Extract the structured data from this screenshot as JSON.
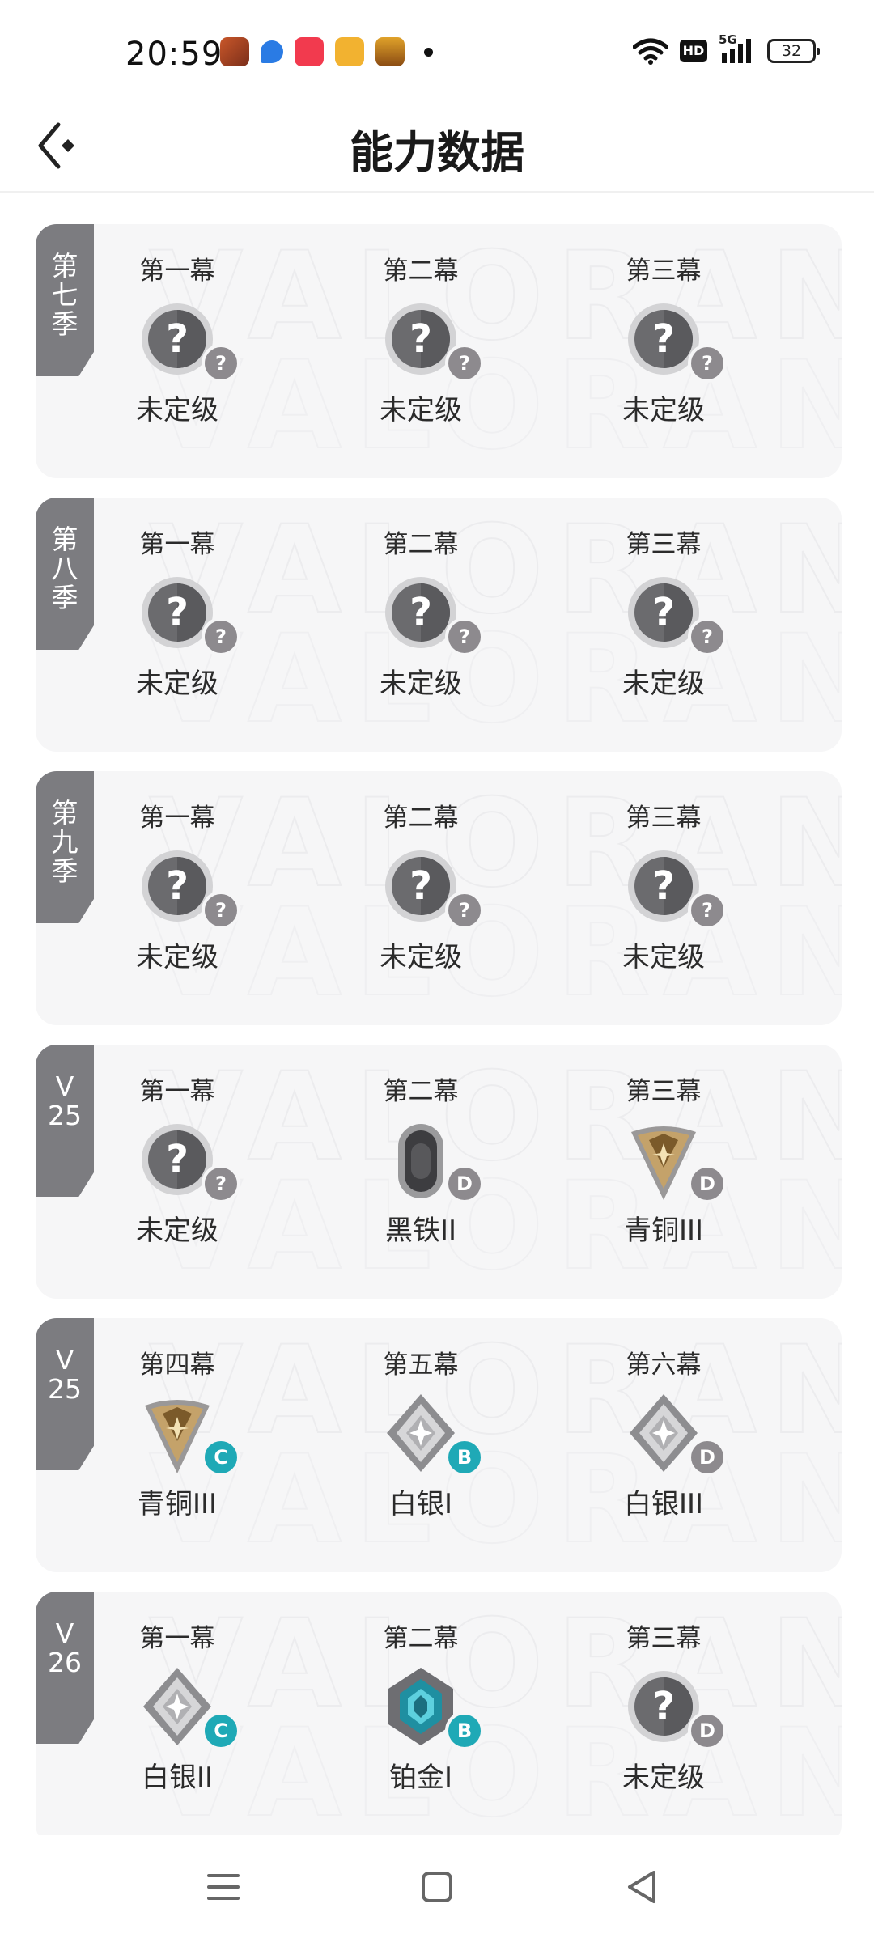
{
  "status_bar": {
    "time": "20:59",
    "battery": "32",
    "hd": "HD",
    "network": "5G",
    "app_icons": [
      {
        "name": "game-app-icon",
        "color": "#c9572a"
      },
      {
        "name": "chat-app-icon",
        "color": "#2a7be4"
      },
      {
        "name": "music-app-icon",
        "color": "#f23a4e"
      },
      {
        "name": "target-app-icon",
        "color": "#f2b230"
      },
      {
        "name": "store-app-icon",
        "color": "#e0a22a"
      }
    ]
  },
  "header": {
    "title": "能力数据"
  },
  "watermark": "VALORANT",
  "colors": {
    "tab": "#7c7c80",
    "card": "#f6f6f7",
    "grade_teal": "#1fa9b6",
    "grade_grey": "#8d8a8e"
  },
  "seasons": [
    {
      "tab": [
        "第",
        "七",
        "季"
      ],
      "acts": [
        {
          "label": "第一幕",
          "rank": "未定级",
          "icon": "unranked-icon",
          "grade": "?"
        },
        {
          "label": "第二幕",
          "rank": "未定级",
          "icon": "unranked-icon",
          "grade": "?"
        },
        {
          "label": "第三幕",
          "rank": "未定级",
          "icon": "unranked-icon",
          "grade": "?"
        }
      ]
    },
    {
      "tab": [
        "第",
        "八",
        "季"
      ],
      "acts": [
        {
          "label": "第一幕",
          "rank": "未定级",
          "icon": "unranked-icon",
          "grade": "?"
        },
        {
          "label": "第二幕",
          "rank": "未定级",
          "icon": "unranked-icon",
          "grade": "?"
        },
        {
          "label": "第三幕",
          "rank": "未定级",
          "icon": "unranked-icon",
          "grade": "?"
        }
      ]
    },
    {
      "tab": [
        "第",
        "九",
        "季"
      ],
      "acts": [
        {
          "label": "第一幕",
          "rank": "未定级",
          "icon": "unranked-icon",
          "grade": "?"
        },
        {
          "label": "第二幕",
          "rank": "未定级",
          "icon": "unranked-icon",
          "grade": "?"
        },
        {
          "label": "第三幕",
          "rank": "未定级",
          "icon": "unranked-icon",
          "grade": "?"
        }
      ]
    },
    {
      "tab": [
        "V",
        "25",
        ""
      ],
      "acts": [
        {
          "label": "第一幕",
          "rank": "未定级",
          "icon": "unranked-icon",
          "grade": "?"
        },
        {
          "label": "第二幕",
          "rank": "黑铁II",
          "icon": "iron-rank-icon",
          "grade": "D"
        },
        {
          "label": "第三幕",
          "rank": "青铜III",
          "icon": "bronze-rank-icon",
          "grade": "D"
        }
      ]
    },
    {
      "tab": [
        "V",
        "25",
        ""
      ],
      "acts": [
        {
          "label": "第四幕",
          "rank": "青铜III",
          "icon": "bronze-rank-icon",
          "grade": "C"
        },
        {
          "label": "第五幕",
          "rank": "白银I",
          "icon": "silver-rank-icon",
          "grade": "B"
        },
        {
          "label": "第六幕",
          "rank": "白银III",
          "icon": "silver-rank-icon",
          "grade": "D"
        }
      ]
    },
    {
      "tab": [
        "V",
        "26",
        ""
      ],
      "acts": [
        {
          "label": "第一幕",
          "rank": "白银II",
          "icon": "silver-rank-icon",
          "grade": "C"
        },
        {
          "label": "第二幕",
          "rank": "铂金I",
          "icon": "platinum-rank-icon",
          "grade": "B"
        },
        {
          "label": "第三幕",
          "rank": "未定级",
          "icon": "unranked-icon",
          "grade": "D"
        }
      ]
    }
  ],
  "nav": {
    "menu_icon": "menu-icon",
    "home_icon": "home-square-icon",
    "back_icon": "back-triangle-icon"
  }
}
